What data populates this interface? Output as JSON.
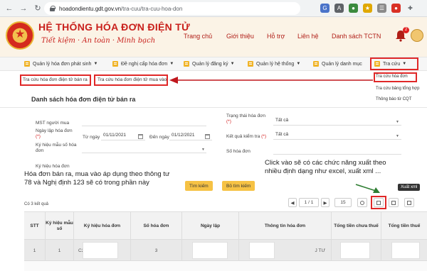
{
  "browser": {
    "url_host": "hoadondientu.gdt.gov.vn",
    "url_path": "/tra-cuu/tra-cuu-hoa-don",
    "nav": [
      "←",
      "→",
      "↻",
      "⌂"
    ]
  },
  "header": {
    "title": "HỆ THỐNG HÓA ĐƠN ĐIỆN TỬ",
    "slogan": "Tiết kiệm · An toàn · Minh bạch",
    "nav": [
      "Trang chủ",
      "Giới thiệu",
      "Hỗ trợ",
      "Liên hệ",
      "Danh sách TCTN"
    ],
    "notification_count": "2"
  },
  "menu": {
    "items": [
      "Quản lý hóa đơn phát sinh",
      "Đề nghị cấp hóa đơn",
      "Quản lý đăng ký",
      "Quản lý hệ thống",
      "Quản lý danh mục",
      "Tra cứu"
    ]
  },
  "subtabs": [
    "Tra cứu hóa đơn điện tử bán ra",
    "Tra cứu hóa đơn điện tử mua vào"
  ],
  "dropdown": [
    "Tra cứu hóa đơn",
    "Tra cứu bảng tổng hợp",
    "Thông báo từ CQT"
  ],
  "page_title": "Danh sách hóa đơn điện tử bán ra",
  "form": {
    "mst_label": "MST người mua",
    "date_label": "Ngày lập hóa đơn",
    "required_mark": "(*)",
    "from_label": "Từ ngày",
    "from_value": "01/11/2021",
    "to_label": "Đến ngày",
    "to_value": "01/12/2021",
    "symbol_label": "Ký hiệu mẫu số hóa đơn",
    "invoice_symbol_label": "Ký hiệu hóa đơn",
    "status_label": "Trạng thái hóa đơn",
    "status_value": "Tất cả",
    "check_label": "Kết quả kiểm tra",
    "check_value": "Tất cả",
    "number_label": "Số hóa đơn"
  },
  "buttons": {
    "search": "Tìm kiếm",
    "clear": "Bỏ tìm kiếm"
  },
  "notes": {
    "left": "Hóa đơn bán ra, mua vào áp dụng theo thông tư 78 và Nghị định 123 sẽ có trong phần này",
    "right": "Click vào sẽ có các chức năng xuất theo nhiều định dạng như excel, xuất xml ..."
  },
  "tooltip": "Xuất xml",
  "results": {
    "count_text": "Có 3 kết quả",
    "page": "1 / 1",
    "page_size": "15"
  },
  "table": {
    "headers": [
      "STT",
      "Ký hiệu mẫu số",
      "Ký hiệu hóa đơn",
      "Số hóa đơn",
      "Ngày lập",
      "Thông tin hóa đơn",
      "Tổng tiền chưa thuế",
      "Tổng tiền thuế"
    ],
    "rows": [
      {
        "stt": "1",
        "mau_so": "1",
        "ky_hieu_prefix": "C2",
        "so_hd": "3",
        "thong_tin_suffix": "J TƯ"
      }
    ]
  }
}
